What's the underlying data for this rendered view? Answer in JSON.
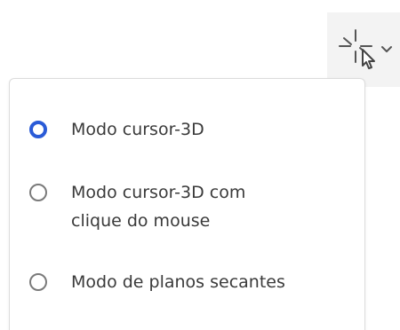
{
  "toolbar": {
    "tool_icon": "cursor-3d-icon",
    "dropdown_icon": "chevron-down-icon"
  },
  "menu": {
    "options": [
      {
        "label": "Modo cursor-3D",
        "selected": true
      },
      {
        "label": "Modo cursor-3D com\nclique do mouse",
        "selected": false
      },
      {
        "label": "Modo de planos secantes",
        "selected": false
      }
    ]
  },
  "colors": {
    "accent": "#2a5bd7",
    "panel_border": "#dcdcdc",
    "text": "#3a3a3a",
    "button_bg": "#f3f3f3"
  }
}
